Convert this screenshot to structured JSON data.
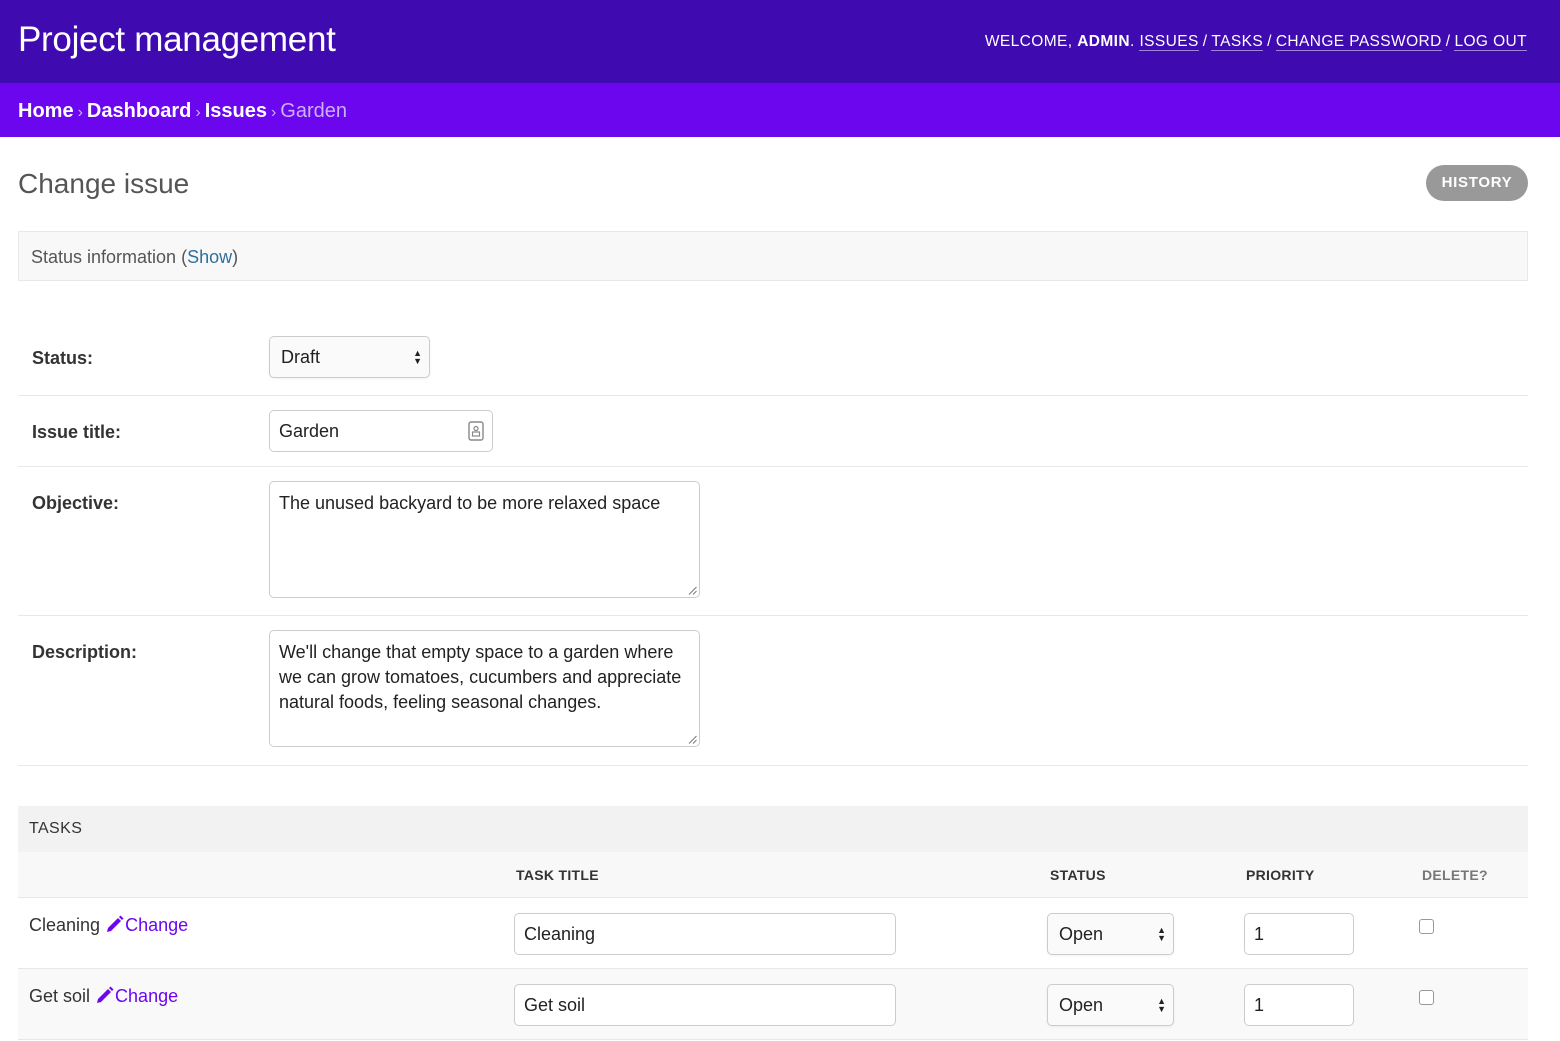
{
  "header": {
    "branding": "Project management",
    "welcome": "WELCOME,",
    "user": "ADMIN",
    "links": [
      "ISSUES",
      "TASKS",
      "CHANGE PASSWORD",
      "LOG OUT"
    ]
  },
  "breadcrumbs": {
    "items": [
      "Home",
      "Dashboard",
      "Issues"
    ],
    "current": "Garden"
  },
  "page": {
    "title": "Change issue",
    "history_label": "HISTORY"
  },
  "status_info": {
    "text": "Status information (",
    "link": "Show",
    "close": ")"
  },
  "form": {
    "status_label": "Status:",
    "status_value": "Draft",
    "title_label": "Issue title:",
    "title_value": "Garden",
    "objective_label": "Objective:",
    "objective_value": "The unused backyard to be more relaxed space",
    "description_label": "Description:",
    "description_value": "We'll change that empty space to a garden where we can grow tomatoes, cucumbers and appreciate natural foods, feeling seasonal changes."
  },
  "tasks": {
    "heading": "TASKS",
    "columns": [
      "TASK TITLE",
      "STATUS",
      "PRIORITY",
      "DELETE?"
    ],
    "change_label": "Change",
    "rows": [
      {
        "name": "Cleaning",
        "title": "Cleaning",
        "status": "Open",
        "priority": "1"
      },
      {
        "name": "Get soil",
        "title": "Get soil",
        "status": "Open",
        "priority": "1"
      }
    ]
  },
  "colors": {
    "header": "#3f0ab0",
    "breadcrumbs": "#6b06ef",
    "link": "#6b06ef",
    "history_button": "#999999"
  }
}
